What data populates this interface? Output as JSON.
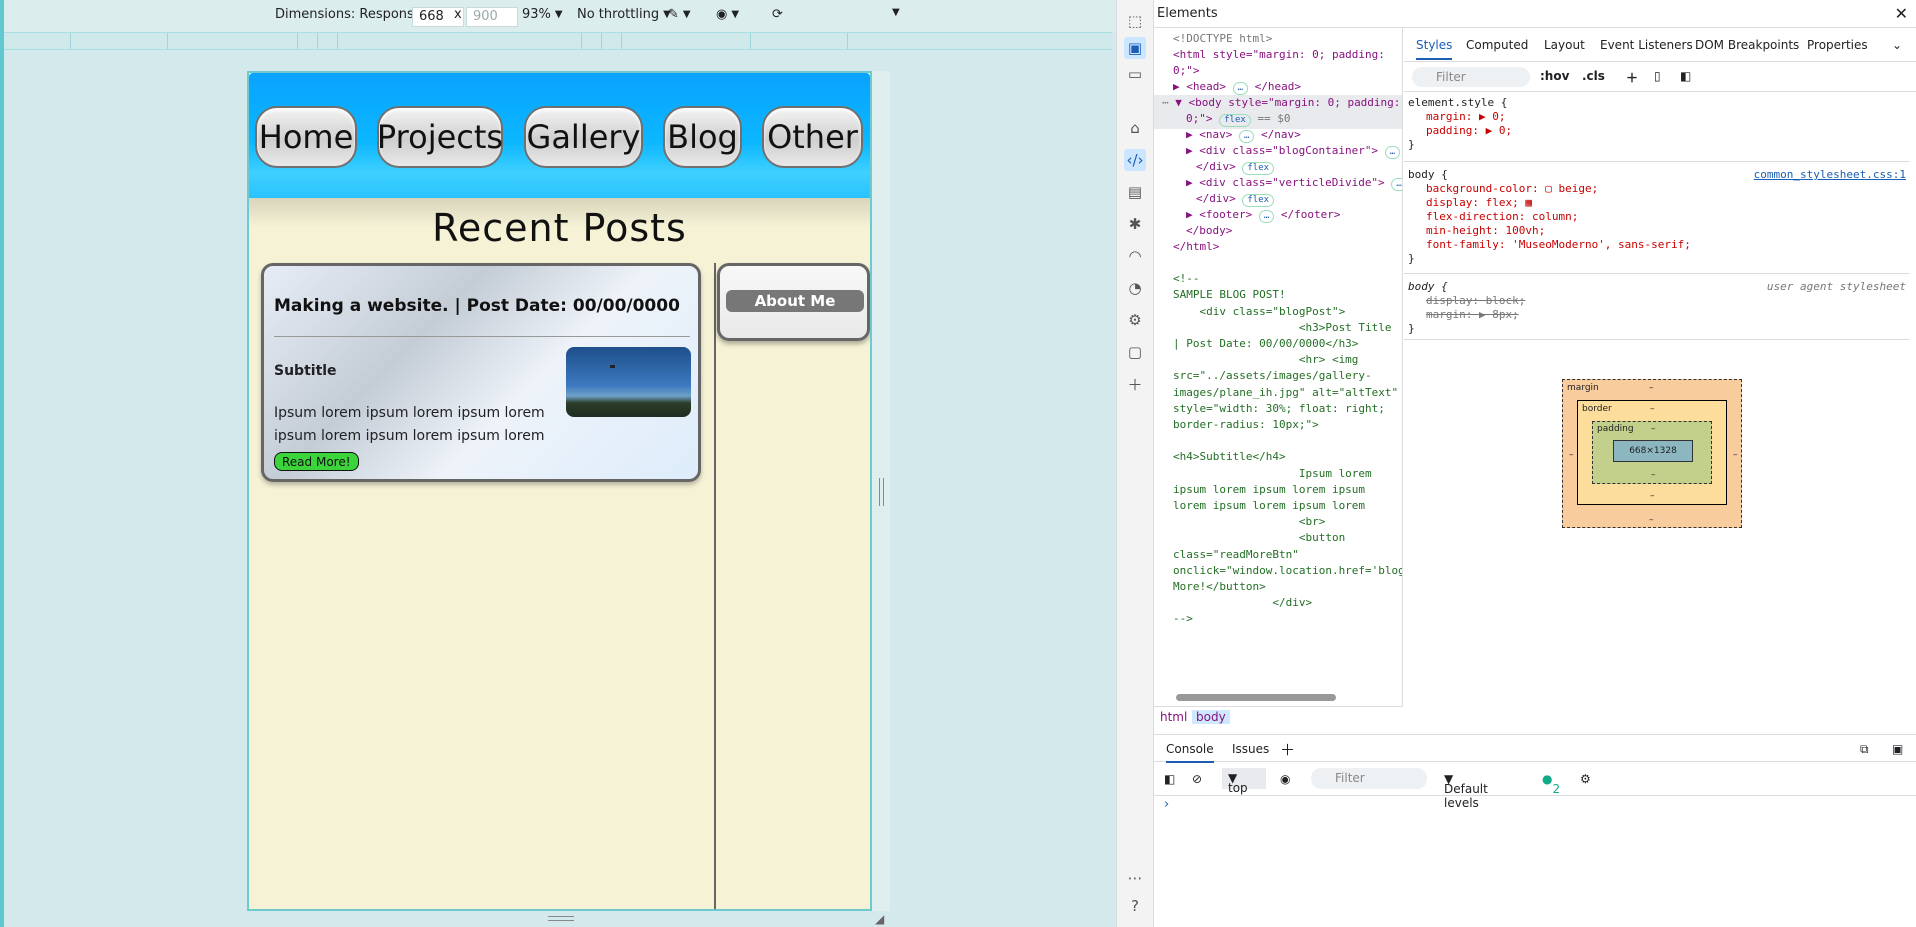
{
  "device_toolbar": {
    "dimensions_label": "Dimensions: Responsive",
    "width_value": "668",
    "times": "x",
    "height_placeholder": "900",
    "zoom": "93%",
    "throttling": "No throttling"
  },
  "page": {
    "nav_items": [
      "Home",
      "Projects",
      "Gallery",
      "Blog",
      "Other"
    ],
    "heading": "Recent Posts",
    "post": {
      "title": "Making a website. | Post Date: 00/00/0000",
      "subtitle": "Subtitle",
      "body": "Ipsum lorem ipsum lorem ipsum lorem ipsum lorem ipsum lorem ipsum lorem",
      "button": "Read More!"
    },
    "about_label": "About Me",
    "colors": {
      "nav_blue": "#0bb7ff",
      "page_bg": "#f5f2d6",
      "read_more_green": "#3bd43b"
    }
  },
  "devtools": {
    "title": "Elements",
    "close": "✕",
    "dom": {
      "doctype": "<!DOCTYPE html>",
      "html_open": "<html style=\"margin: 0; padding:",
      "html_open_2": "0;\">",
      "head": "<head>",
      "head_close": "</head>",
      "body_open": "<body style=\"margin: 0; padding:",
      "body_open_2": "0;\">",
      "flex_badge": "flex",
      "eq": "== $0",
      "nav": "<nav>",
      "nav_close": "</nav>",
      "blog_container": "<div class=\"blogContainer\">",
      "div_close": "</div>",
      "vdiv": "<div class=\"verticleDivide\">",
      "footer": "<footer>",
      "footer_close": "</footer>",
      "body_close": "</body>",
      "html_close": "</html>",
      "comment_lines": [
        "<!--",
        "SAMPLE BLOG POST!",
        "    <div class=\"blogPost\">",
        "                   <h3>Post Title",
        "| Post Date: 00/00/0000</h3>",
        "                   <hr> <img",
        "src=\"../assets/images/gallery-",
        "images/plane_ih.jpg\" alt=\"altText\"",
        "style=\"width: 30%; float: right;",
        "border-radius: 10px;\">",
        "",
        "<h4>Subtitle</h4>",
        "                   Ipsum lorem",
        "ipsum lorem ipsum lorem ipsum",
        "lorem ipsum lorem ipsum lorem",
        "                   <br>",
        "                   <button",
        "class=\"readMoreBtn\"",
        "onclick=\"window.location.href='blog",
        "More!</button>",
        "               </div>",
        "-->"
      ]
    },
    "breadcrumbs": [
      "html",
      "body"
    ],
    "style_tabs": [
      "Styles",
      "Computed",
      "Layout",
      "Event Listeners",
      "DOM Breakpoints",
      "Properties"
    ],
    "filter_placeholder": "Filter",
    "hov": ":hov",
    "cls": ".cls",
    "element_style": {
      "selector": "element.style {",
      "lines": [
        "margin: ▶ 0;",
        "padding: ▶ 0;"
      ]
    },
    "body_rule": {
      "selector": "body {",
      "source": "common_stylesheet.css:1",
      "lines": [
        "background-color: ▢ beige;",
        "display: flex; ▦",
        "flex-direction: column;",
        "min-height: 100vh;",
        "font-family: 'MuseoModerno', sans-serif;"
      ]
    },
    "ua_rule": {
      "selector": "body {",
      "source": "user agent stylesheet",
      "lines": [
        "display: block;",
        "margin: ▶ 8px;"
      ]
    },
    "box_model": {
      "margin": "margin",
      "border": "border",
      "padding": "padding",
      "dash": "–",
      "content": "668×1328"
    },
    "console_tabs": [
      "Console",
      "Issues"
    ],
    "console_top": "top",
    "console_filter": "Filter",
    "levels": "Default levels",
    "issues_count": "2",
    "prompt": "›"
  }
}
